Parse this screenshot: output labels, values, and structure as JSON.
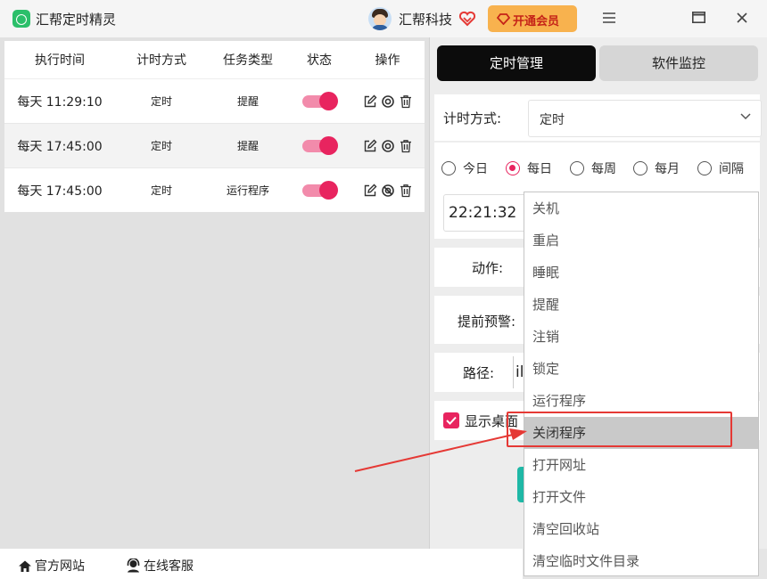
{
  "app": {
    "title": "汇帮定时精灵"
  },
  "user": {
    "name": "汇帮科技",
    "vip_button": "开通会员"
  },
  "colors": {
    "accent": "#e8245f",
    "toggle_track": "#f28bab",
    "vip_bg": "#f8b24e",
    "highlight": "#e53935",
    "teal": "#1fb8a6"
  },
  "table": {
    "headers": [
      "执行时间",
      "计时方式",
      "任务类型",
      "状态",
      "操作"
    ],
    "rows": [
      {
        "time": "每天 11:29:10",
        "mode": "定时",
        "type": "提醒",
        "enabled": true
      },
      {
        "time": "每天 17:45:00",
        "mode": "定时",
        "type": "提醒",
        "enabled": true
      },
      {
        "time": "每天 17:45:00",
        "mode": "定时",
        "type": "运行程序",
        "enabled": true
      }
    ],
    "action_icons": [
      "edit-icon",
      "target-icon",
      "trash-icon"
    ]
  },
  "tabs": {
    "active": "定时管理",
    "other": "软件监控"
  },
  "form": {
    "mode_label": "计时方式:",
    "mode_value": "定时",
    "radios": [
      {
        "label": "今日",
        "checked": false
      },
      {
        "label": "每日",
        "checked": true
      },
      {
        "label": "每周",
        "checked": false
      },
      {
        "label": "每月",
        "checked": false
      },
      {
        "label": "间隔",
        "checked": false
      }
    ],
    "time_value": "22:21:32",
    "action_label": "动作:",
    "warning_label": "提前预警:",
    "path_label": "路径:",
    "path_value": "il",
    "checkbox_label": "显示桌面",
    "checkbox_checked": true
  },
  "dropdown": {
    "items": [
      "关机",
      "重启",
      "睡眠",
      "提醒",
      "注销",
      "锁定",
      "运行程序",
      "关闭程序",
      "打开网址",
      "打开文件",
      "清空回收站",
      "清空临时文件目录"
    ],
    "highlighted": "关闭程序"
  },
  "footer": {
    "website": "官方网站",
    "support": "在线客服"
  }
}
